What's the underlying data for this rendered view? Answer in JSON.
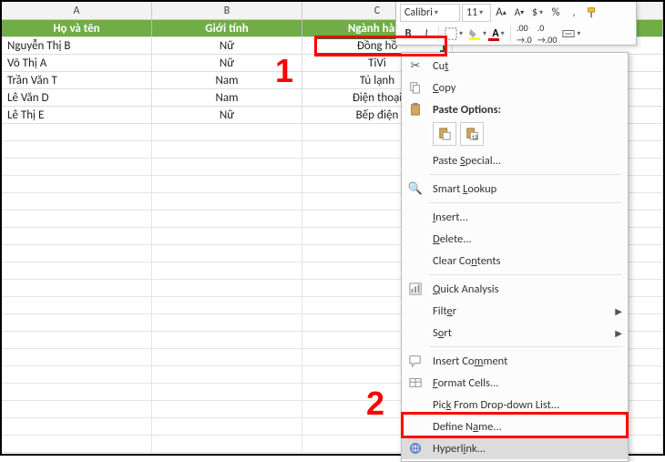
{
  "toolbar": {
    "font_name": "Calibri",
    "font_size": "11",
    "bold": "B",
    "italic": "I",
    "percent": "%",
    "comma": ","
  },
  "columns": {
    "a": "A",
    "b": "B",
    "c": "C"
  },
  "table_header": {
    "a": "Họ và tên",
    "b": "Giới tính",
    "c": "Ngành hàng"
  },
  "rows": [
    {
      "a": "Nguyễn Thị B",
      "b": "Nữ",
      "c": "Đồng hồ"
    },
    {
      "a": "Võ Thị A",
      "b": "Nữ",
      "c": "TiVi"
    },
    {
      "a": "Trần Văn T",
      "b": "Nam",
      "c": "Tủ lạnh"
    },
    {
      "a": "Lê Văn D",
      "b": "Nam",
      "c": "Điện thoại"
    },
    {
      "a": "Lê Thị E",
      "b": "Nữ",
      "c": "Bếp điện"
    }
  ],
  "ctx": {
    "cut": "Cut",
    "copy": "Copy",
    "paste_header": "Paste Options:",
    "paste_special": "Paste Special...",
    "smart_lookup": "Smart Lookup",
    "insert": "Insert...",
    "delete": "Delete...",
    "clear": "Clear Contents",
    "quick_analysis": "Quick Analysis",
    "filter": "Filter",
    "sort": "Sort",
    "insert_comment": "Insert Comment",
    "format_cells": "Format Cells...",
    "pick_list": "Pick From Drop-down List...",
    "define_name": "Define Name...",
    "hyperlink": "Hyperlink..."
  },
  "annotations": {
    "one": "1",
    "two": "2"
  }
}
